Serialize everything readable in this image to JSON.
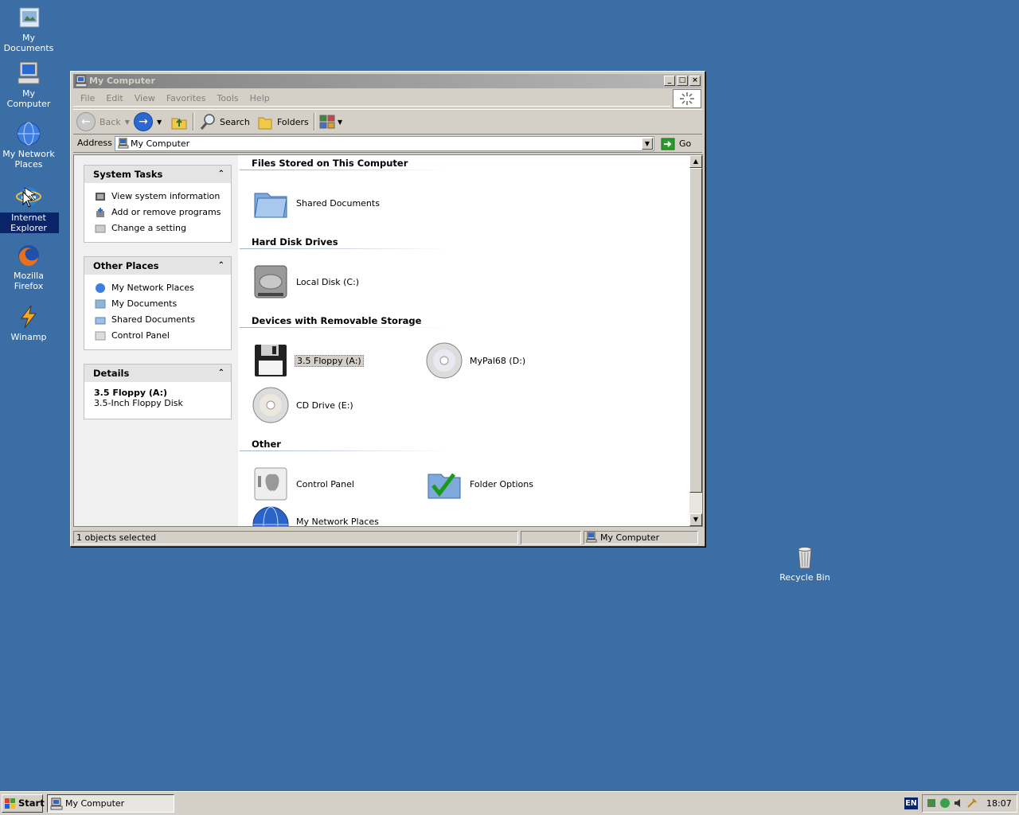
{
  "desktop": {
    "icons": [
      {
        "label": "My Documents"
      },
      {
        "label": "My Computer"
      },
      {
        "label": "My Network Places"
      },
      {
        "label": "Internet Explorer"
      },
      {
        "label": "Mozilla Firefox"
      },
      {
        "label": "Winamp"
      },
      {
        "label": "Recycle Bin"
      }
    ],
    "background": "#3a6ea5"
  },
  "window": {
    "title": "My Computer",
    "menu": [
      "File",
      "Edit",
      "View",
      "Favorites",
      "Tools",
      "Help"
    ],
    "toolbar": {
      "back": "Back",
      "search": "Search",
      "folders": "Folders"
    },
    "address": {
      "label": "Address",
      "value": "My Computer",
      "go": "Go"
    },
    "tasks": {
      "system": {
        "title": "System Tasks",
        "items": [
          "View system information",
          "Add or remove programs",
          "Change a setting"
        ]
      },
      "other": {
        "title": "Other Places",
        "items": [
          "My Network Places",
          "My Documents",
          "Shared Documents",
          "Control Panel"
        ]
      },
      "details": {
        "title": "Details",
        "name": "3.5 Floppy (A:)",
        "type": "3.5-Inch Floppy Disk"
      }
    },
    "groups": {
      "stored": {
        "title": "Files Stored on This Computer",
        "items": [
          "Shared Documents"
        ]
      },
      "hdd": {
        "title": "Hard Disk Drives",
        "items": [
          "Local Disk (C:)"
        ]
      },
      "removable": {
        "title": "Devices with Removable Storage",
        "items": [
          "3.5 Floppy (A:)",
          "MyPal68 (D:)",
          "CD Drive (E:)"
        ]
      },
      "other": {
        "title": "Other",
        "items": [
          "Control Panel",
          "Folder Options",
          "My Network Places"
        ]
      }
    },
    "status": {
      "left": "1 objects selected",
      "right": "My Computer"
    }
  },
  "taskbar": {
    "start": "Start",
    "task": "My Computer",
    "lang": "EN",
    "clock": "18:07"
  }
}
